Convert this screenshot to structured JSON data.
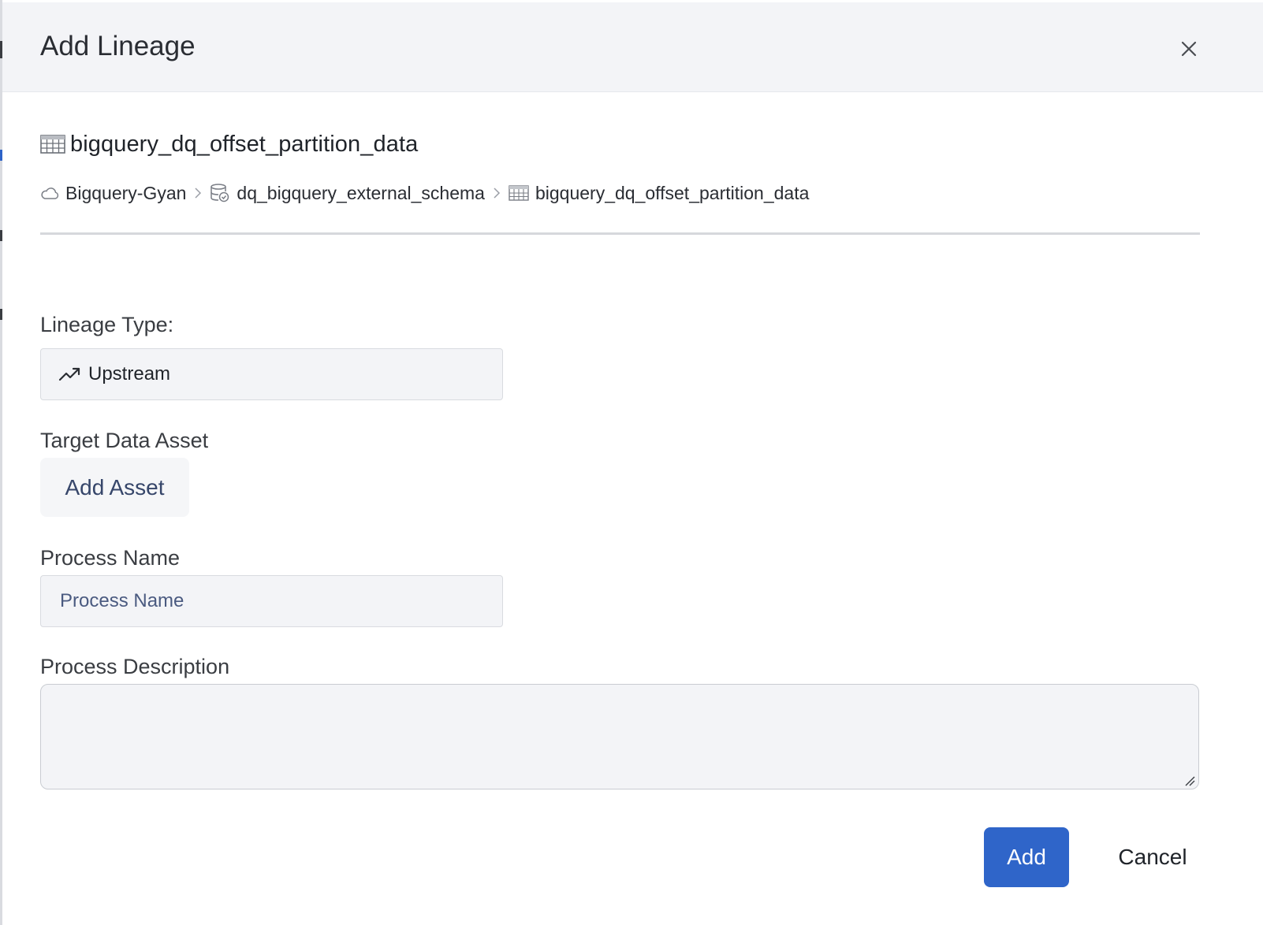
{
  "dialog": {
    "title": "Add Lineage",
    "close_icon": "close-icon"
  },
  "asset": {
    "icon": "table-icon",
    "name": "bigquery_dq_offset_partition_data"
  },
  "breadcrumb": [
    {
      "icon": "cloud-icon",
      "label": "Bigquery-Gyan"
    },
    {
      "icon": "database-schema-icon",
      "label": "dq_bigquery_external_schema"
    },
    {
      "icon": "table-icon",
      "label": "bigquery_dq_offset_partition_data"
    }
  ],
  "form": {
    "lineage_type_label": "Lineage Type:",
    "lineage_type_value": "Upstream",
    "lineage_type_icon": "trending-up-icon",
    "target_asset_label": "Target Data Asset",
    "add_asset_label": "Add Asset",
    "process_name_label": "Process Name",
    "process_name_placeholder": "Process Name",
    "process_name_value": "",
    "process_description_label": "Process Description",
    "process_description_value": ""
  },
  "actions": {
    "add_label": "Add",
    "cancel_label": "Cancel"
  },
  "colors": {
    "primary": "#2f65c9",
    "header_bg": "#f3f4f7",
    "input_bg": "#f3f4f7"
  }
}
